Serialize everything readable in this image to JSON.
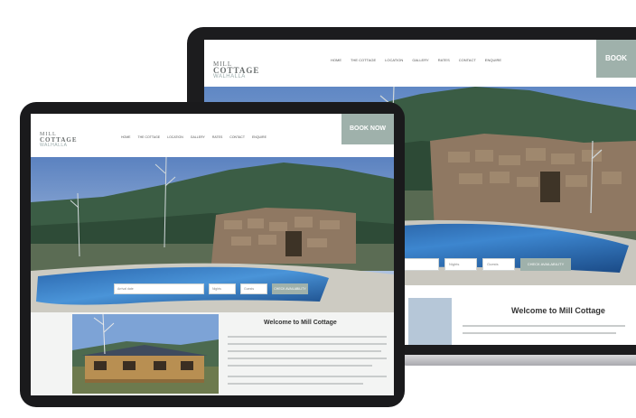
{
  "site": {
    "logo_line1": "MILL",
    "logo_line2": "COTTAGE",
    "logo_line3": "WALHALLA",
    "nav_items": [
      "Home",
      "The Cottage",
      "Location",
      "Gallery",
      "Rates",
      "Contact",
      "Enquire"
    ],
    "book_now_label": "BOOK NOW",
    "booking": {
      "arrival_placeholder": "Arrival date",
      "nights_placeholder": "Nights",
      "guests_placeholder": "Guests",
      "search_label": "CHECK AVAILABILITY"
    },
    "welcome_heading": "Welcome to Mill Cottage"
  },
  "colors": {
    "accent": "#9fb1ab",
    "device_frame": "#1c1c1e",
    "pool": "#2f6fb4"
  }
}
